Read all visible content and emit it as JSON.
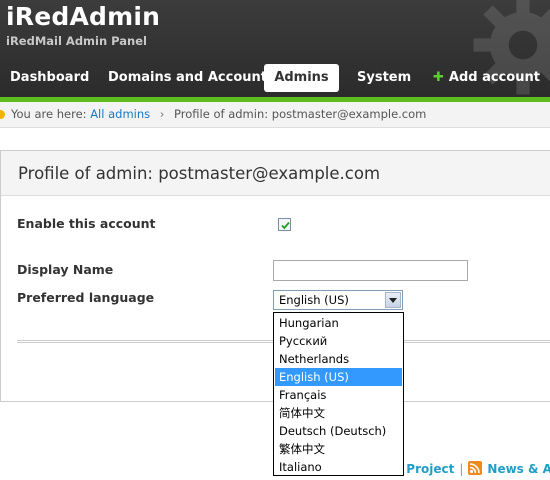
{
  "app": {
    "title": "iRedAdmin",
    "subtitle": "iRedMail Admin Panel"
  },
  "nav": {
    "items": [
      {
        "label": "Dashboard",
        "active": false
      },
      {
        "label": "Domains and Accounts",
        "active": false
      },
      {
        "label": "Admins",
        "active": true
      },
      {
        "label": "System",
        "active": false
      }
    ],
    "add_account": {
      "icon": "plus-icon",
      "label": "Add account"
    }
  },
  "breadcrumb": {
    "prefix": "You are here:",
    "link": "All admins",
    "separator": "›",
    "current": "Profile of admin: postmaster@example.com"
  },
  "page": {
    "title": "Profile of admin: postmaster@example.com"
  },
  "form": {
    "enable_account": {
      "label": "Enable this account",
      "checked": true
    },
    "display_name": {
      "label": "Display Name",
      "value": ""
    },
    "preferred_language": {
      "label": "Preferred language",
      "value": "English (US)",
      "options": [
        "Hungarian",
        "Русский",
        "Netherlands",
        "English (US)",
        "Français",
        "简体中文",
        "Deutsch (Deutsch)",
        "繁体中文",
        "Italiano"
      ],
      "selected_index": 3
    }
  },
  "footer": {
    "project_link": "l Project",
    "separator": "|",
    "news_link": "News & An"
  },
  "colors": {
    "header_bg": "#2f2f2f",
    "accent_green": "#5dbd1f",
    "link_blue": "#1978c6",
    "selection_blue": "#3399ff"
  }
}
